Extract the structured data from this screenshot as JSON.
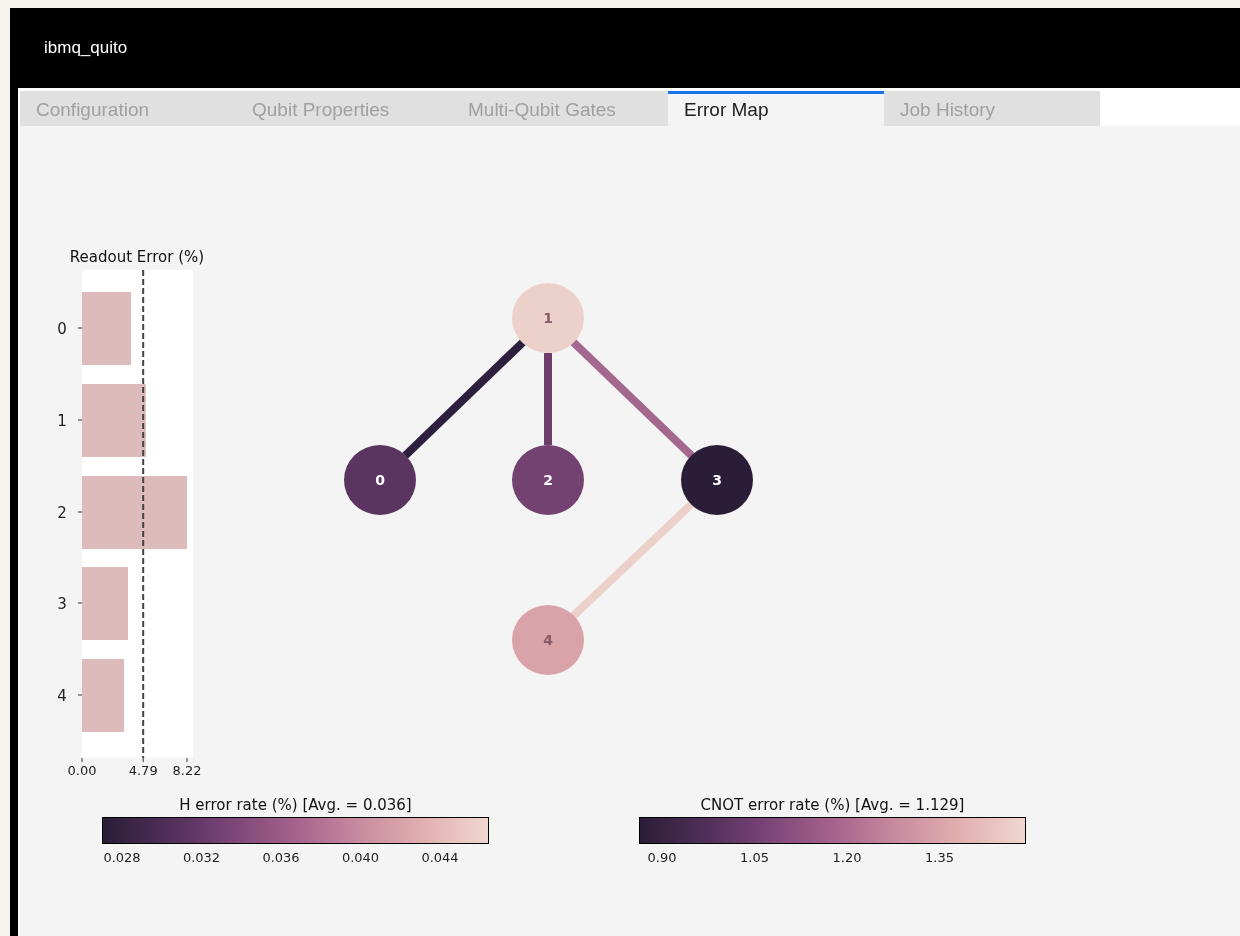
{
  "window": {
    "title": "ibmq_quito"
  },
  "tabs": [
    {
      "label": "Configuration",
      "selected": false
    },
    {
      "label": "Qubit Properties",
      "selected": false
    },
    {
      "label": "Multi-Qubit Gates",
      "selected": false
    },
    {
      "label": "Error Map",
      "selected": true
    },
    {
      "label": "Job History",
      "selected": false
    }
  ],
  "readout_chart": {
    "chart_data": {
      "type": "bar",
      "orientation": "horizontal",
      "title": "Readout Error (%)",
      "categories": [
        "0",
        "1",
        "2",
        "3",
        "4"
      ],
      "values": [
        3.84,
        5.0,
        8.22,
        3.6,
        3.3
      ],
      "xlim": [
        0,
        8.69
      ],
      "xticks": [
        {
          "value": 0,
          "label": "0.00"
        },
        {
          "value": 4.79,
          "label": "4.79"
        },
        {
          "value": 8.22,
          "label": "8.22"
        }
      ],
      "ref_lines": [
        {
          "axis": "x",
          "value": 4.79
        }
      ]
    }
  },
  "error_map": {
    "nodes": [
      {
        "label": "0",
        "color": "#5a3560"
      },
      {
        "label": "1",
        "color": "#ecd0ca"
      },
      {
        "label": "2",
        "color": "#734270"
      },
      {
        "label": "3",
        "color": "#2a1d38"
      },
      {
        "label": "4",
        "color": "#d9a3a9"
      }
    ],
    "edges": [
      {
        "color": "#2e1f3e"
      },
      {
        "color": "#6c3d68"
      },
      {
        "color": "#a4688f"
      },
      {
        "color": "#ecd0ca"
      }
    ]
  },
  "colorbars": [
    {
      "title": "H error rate (%) [Avg. = 0.036]",
      "ticks": [
        "0.028",
        "0.032",
        "0.036",
        "0.040",
        "0.044"
      ]
    },
    {
      "title": "CNOT error rate (%) [Avg. = 1.129]",
      "ticks": [
        "0.90",
        "1.05",
        "1.20",
        "1.35"
      ]
    }
  ]
}
